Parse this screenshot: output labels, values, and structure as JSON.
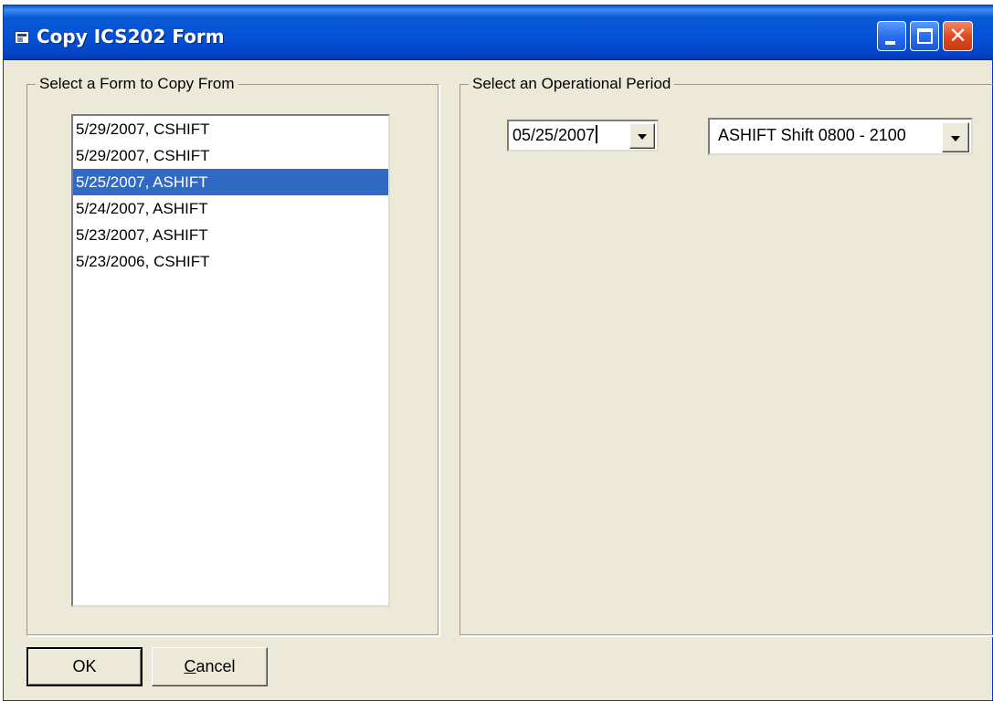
{
  "window": {
    "title": "Copy ICS202 Form",
    "icon": "form-window-icon",
    "controls": {
      "minimize": "minimize-icon",
      "maximize": "maximize-icon",
      "close": "close-icon",
      "close_glyph": "✕"
    }
  },
  "left_group": {
    "label": "Select a Form to Copy From",
    "items": [
      {
        "label": "5/29/2007, CSHIFT",
        "selected": false
      },
      {
        "label": "5/29/2007, CSHIFT",
        "selected": false
      },
      {
        "label": "5/25/2007, ASHIFT",
        "selected": true
      },
      {
        "label": "5/24/2007, ASHIFT",
        "selected": false
      },
      {
        "label": "5/23/2007, ASHIFT",
        "selected": false
      },
      {
        "label": "5/23/2006, CSHIFT",
        "selected": false
      }
    ]
  },
  "right_group": {
    "label": "Select an Operational Period",
    "date_value": "05/25/2007",
    "shift_value": "ASHIFT Shift 0800 - 2100"
  },
  "buttons": {
    "ok_label": "OK",
    "cancel_first": "C",
    "cancel_rest": "ancel"
  },
  "colors": {
    "selection": "#316ac5",
    "title_bar": "#0551d6",
    "window_face": "#ece9d8"
  }
}
